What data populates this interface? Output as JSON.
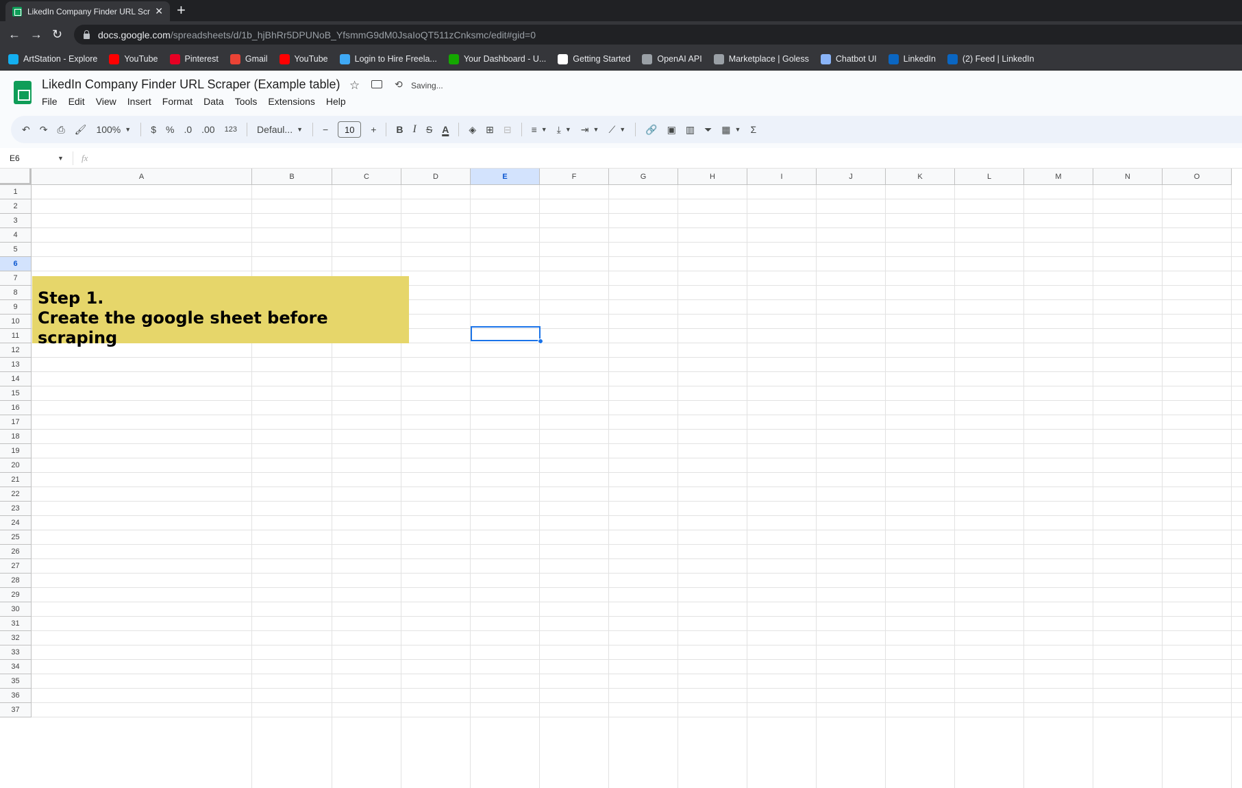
{
  "browser": {
    "tab_title": "LikedIn Company Finder URL Scr",
    "url_host": "docs.google.com",
    "url_path": "/spreadsheets/d/1b_hjBhRr5DPUNoB_YfsmmG9dM0JsaIoQT511zCnksmc/edit#gid=0",
    "bookmarks": [
      {
        "label": "ArtStation - Explore",
        "color": "#13aff0"
      },
      {
        "label": "YouTube",
        "color": "#ff0000"
      },
      {
        "label": "Pinterest",
        "color": "#e60023"
      },
      {
        "label": "Gmail",
        "color": "#ea4335"
      },
      {
        "label": "YouTube",
        "color": "#ff0000"
      },
      {
        "label": "Login to Hire Freela...",
        "color": "#3fa9f5"
      },
      {
        "label": "Your Dashboard - U...",
        "color": "#14a800"
      },
      {
        "label": "Getting Started",
        "color": "#ffffff"
      },
      {
        "label": "OpenAI API",
        "color": "#9aa0a6"
      },
      {
        "label": "Marketplace | Goless",
        "color": "#9aa0a6"
      },
      {
        "label": "Chatbot UI",
        "color": "#8ab4f8"
      },
      {
        "label": "LinkedIn",
        "color": "#0a66c2"
      },
      {
        "label": "(2) Feed | LinkedIn",
        "color": "#0a66c2"
      }
    ]
  },
  "sheet": {
    "title": "LikedIn Company Finder URL Scraper (Example table)",
    "status": "Saving...",
    "menu": [
      "File",
      "Edit",
      "View",
      "Insert",
      "Format",
      "Data",
      "Tools",
      "Extensions",
      "Help"
    ],
    "toolbar": {
      "zoom": "100%",
      "currency": "$",
      "percent": "%",
      "dec_decrease": ".0",
      "dec_increase": ".00",
      "format_123": "123",
      "font": "Defaul...",
      "font_size": "10",
      "bold": "B",
      "italic": "I",
      "text_color": "A",
      "sum": "Σ"
    },
    "name_box": "E6",
    "fx_label": "fx",
    "columns": [
      "A",
      "B",
      "C",
      "D",
      "E",
      "F",
      "G",
      "H",
      "I",
      "J",
      "K",
      "L",
      "M",
      "N",
      "O"
    ],
    "selected_column": "E",
    "selected_row": 6,
    "row_count": 37,
    "note": {
      "line1": "Step 1.",
      "line2": "Create the google sheet before scraping",
      "color": "#e6d66a"
    }
  }
}
